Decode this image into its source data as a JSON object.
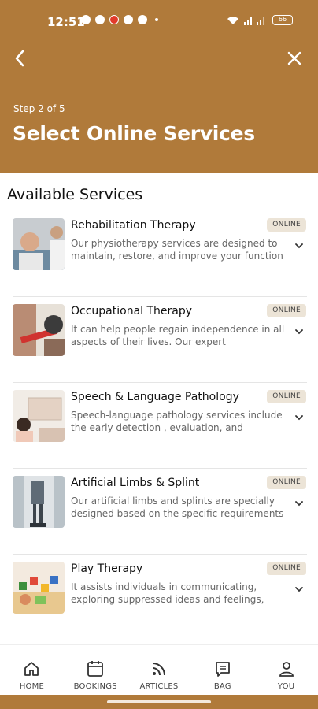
{
  "status_bar": {
    "time": "12:51",
    "battery": "66"
  },
  "header": {
    "step_label": "Step 2 of 5",
    "title": "Select Online Services"
  },
  "section_title": "Available Services",
  "services": [
    {
      "title": "Rehabilitation Therapy",
      "desc": "Our physiotherapy services are designed to maintain, restore, and improve your function",
      "badge": "ONLINE"
    },
    {
      "title": "Occupational Therapy",
      "desc": "It can help people regain independence in all aspects of their lives. Our expert",
      "badge": "ONLINE"
    },
    {
      "title": "Speech & Language Pathology",
      "desc": "Speech-language pathology services include the early detection , evaluation, and",
      "badge": "ONLINE"
    },
    {
      "title": "Artificial Limbs & Splint",
      "desc": "Our artificial limbs and splints are specially designed based on the specific requirements",
      "badge": "ONLINE"
    },
    {
      "title": "Play Therapy",
      "desc": "It assists individuals in communicating, exploring suppressed ideas and feelings,",
      "badge": "ONLINE"
    }
  ],
  "bottom_nav": [
    {
      "label": "HOME",
      "icon": "home-icon"
    },
    {
      "label": "BOOKINGS",
      "icon": "calendar-icon"
    },
    {
      "label": "ARTICLES",
      "icon": "rss-icon"
    },
    {
      "label": "BAG",
      "icon": "bag-icon"
    },
    {
      "label": "YOU",
      "icon": "user-icon"
    }
  ],
  "colors": {
    "brand": "#b07a3a",
    "badge_bg": "#ece4d7"
  }
}
